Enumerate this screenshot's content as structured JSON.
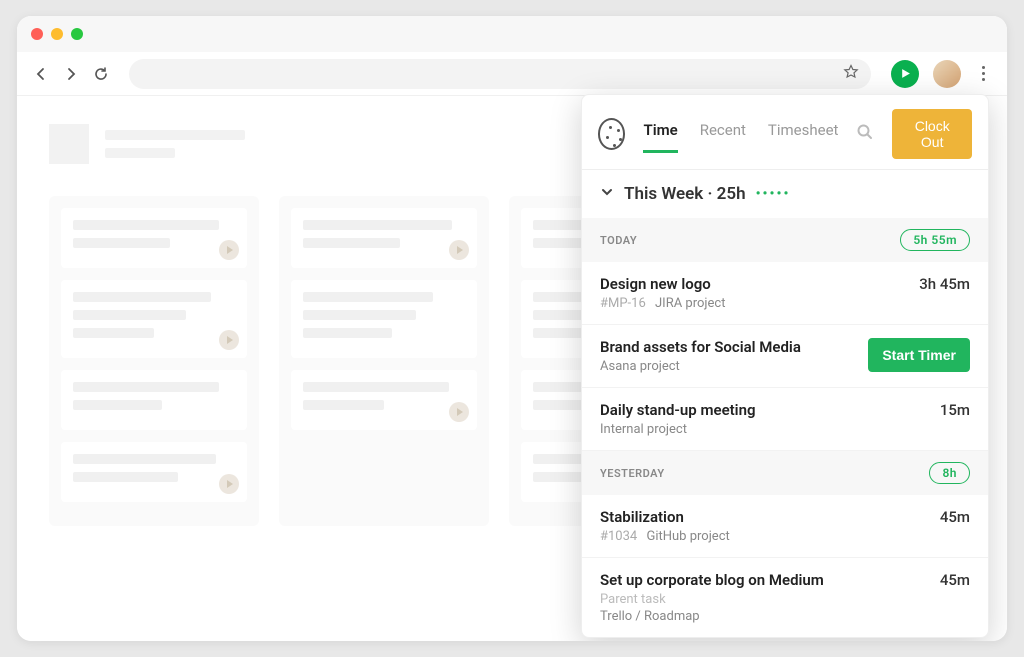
{
  "popup": {
    "tabs": {
      "time": "Time",
      "recent": "Recent",
      "timesheet": "Timesheet"
    },
    "clock_out": "Clock Out",
    "week_label": "This Week · 25h",
    "dots": "•••••",
    "sections": [
      {
        "label": "TODAY",
        "total": "5h 55m",
        "entries": [
          {
            "title": "Design new logo",
            "tag": "#MP-16",
            "project": "JIRA project",
            "time": "3h 45m",
            "action": null
          },
          {
            "title": "Brand assets for Social Media",
            "tag": null,
            "project": "Asana project",
            "time": null,
            "action": "Start Timer"
          },
          {
            "title": "Daily stand-up meeting",
            "tag": null,
            "project": "Internal project",
            "time": "15m",
            "action": null
          }
        ]
      },
      {
        "label": "YESTERDAY",
        "total": "8h",
        "entries": [
          {
            "title": "Stabilization",
            "tag": "#1034",
            "project": "GitHub project",
            "time": "45m",
            "action": null
          },
          {
            "title": "Set up corporate blog on Medium",
            "tag": null,
            "parent": "Parent task",
            "project": "Trello / Roadmap",
            "time": "45m",
            "action": null
          }
        ]
      }
    ]
  }
}
